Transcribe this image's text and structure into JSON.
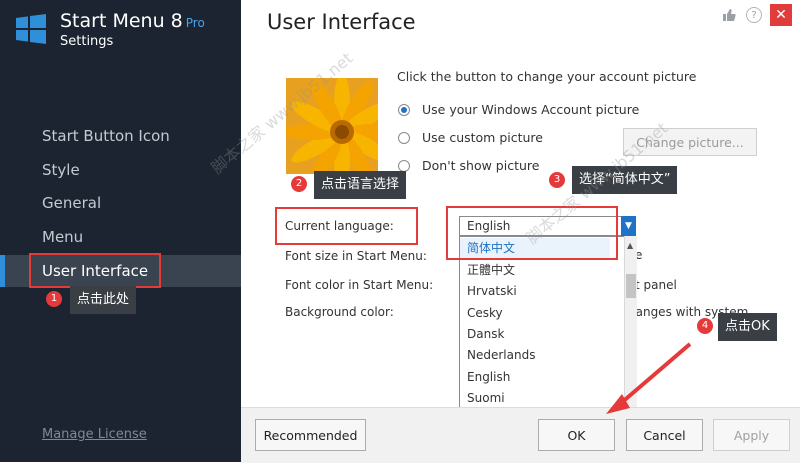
{
  "app": {
    "name": "Start Menu 8",
    "edition": "Pro",
    "subtitle": "Settings"
  },
  "sidebar": {
    "items": [
      {
        "label": "Start Button Icon"
      },
      {
        "label": "Style"
      },
      {
        "label": "General"
      },
      {
        "label": "Menu"
      },
      {
        "label": "User Interface",
        "active": true
      }
    ],
    "manage_license": "Manage License"
  },
  "header": {
    "title": "User Interface"
  },
  "account_picture": {
    "instruction": "Click the button to change your account picture",
    "options": [
      {
        "label": "Use your Windows Account picture",
        "checked": true
      },
      {
        "label": "Use custom picture",
        "checked": false
      },
      {
        "label": "Don't show picture",
        "checked": false
      }
    ],
    "change_button": "Change picture..."
  },
  "settings": {
    "current_language_label": "Current language:",
    "current_language_value": "English",
    "font_size_label": "Font size in Start Menu:",
    "font_color_label": "Font color in Start Menu:",
    "background_color_label": "Background color:",
    "behind_text_1": "e",
    "behind_text_2": "t panel",
    "behind_text_3": "hanges with system"
  },
  "language_options": [
    "简体中文",
    "正體中文",
    "Hrvatski",
    "Cesky",
    "Dansk",
    "Nederlands",
    "English",
    "Suomi"
  ],
  "footer": {
    "recommended": "Recommended",
    "ok": "OK",
    "cancel": "Cancel",
    "apply": "Apply"
  },
  "annotations": [
    {
      "number": "1",
      "text": "点击此处"
    },
    {
      "number": "2",
      "text": "点击语言选择"
    },
    {
      "number": "3",
      "text": "选择“简体中文”"
    },
    {
      "number": "4",
      "text": "点击OK"
    }
  ],
  "watermark": "脚本之家 www.jb51.net",
  "colors": {
    "sidebar_bg": "#1b2430",
    "accent": "#1e73c8",
    "highlight": "#e53a3a",
    "close": "#e13c3c"
  }
}
